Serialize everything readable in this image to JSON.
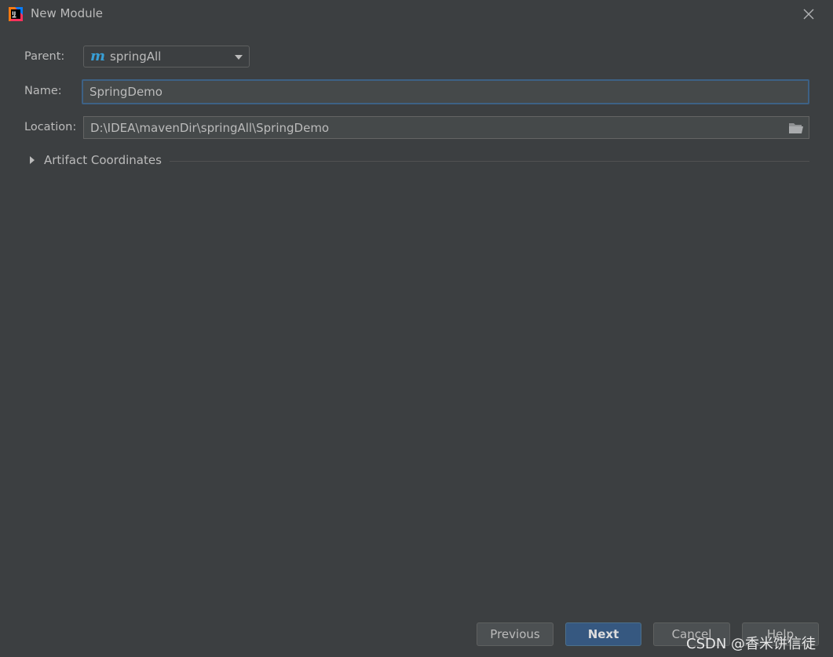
{
  "window": {
    "title": "New Module",
    "app_icon": "intellij-idea-icon",
    "close_icon": "close-icon"
  },
  "form": {
    "parent_label": "Parent:",
    "parent_value": "springAll",
    "parent_icon": "maven-icon",
    "parent_icon_glyph": "m",
    "name_label": "Name:",
    "name_value": "SpringDemo",
    "location_label": "Location:",
    "location_value": "D:\\IDEA\\mavenDir\\springAll\\SpringDemo",
    "location_browse_icon": "folder-icon"
  },
  "artifact": {
    "label": "Artifact Coordinates",
    "expanded": false
  },
  "buttons": {
    "previous": "Previous",
    "next": "Next",
    "cancel": "Cancel",
    "help": "Help"
  },
  "watermark": "CSDN @香米饼信徒",
  "colors": {
    "background": "#3c3f41",
    "focus_border": "#3d6185",
    "default_button": "#365880",
    "maven_icon": "#389fd6"
  }
}
